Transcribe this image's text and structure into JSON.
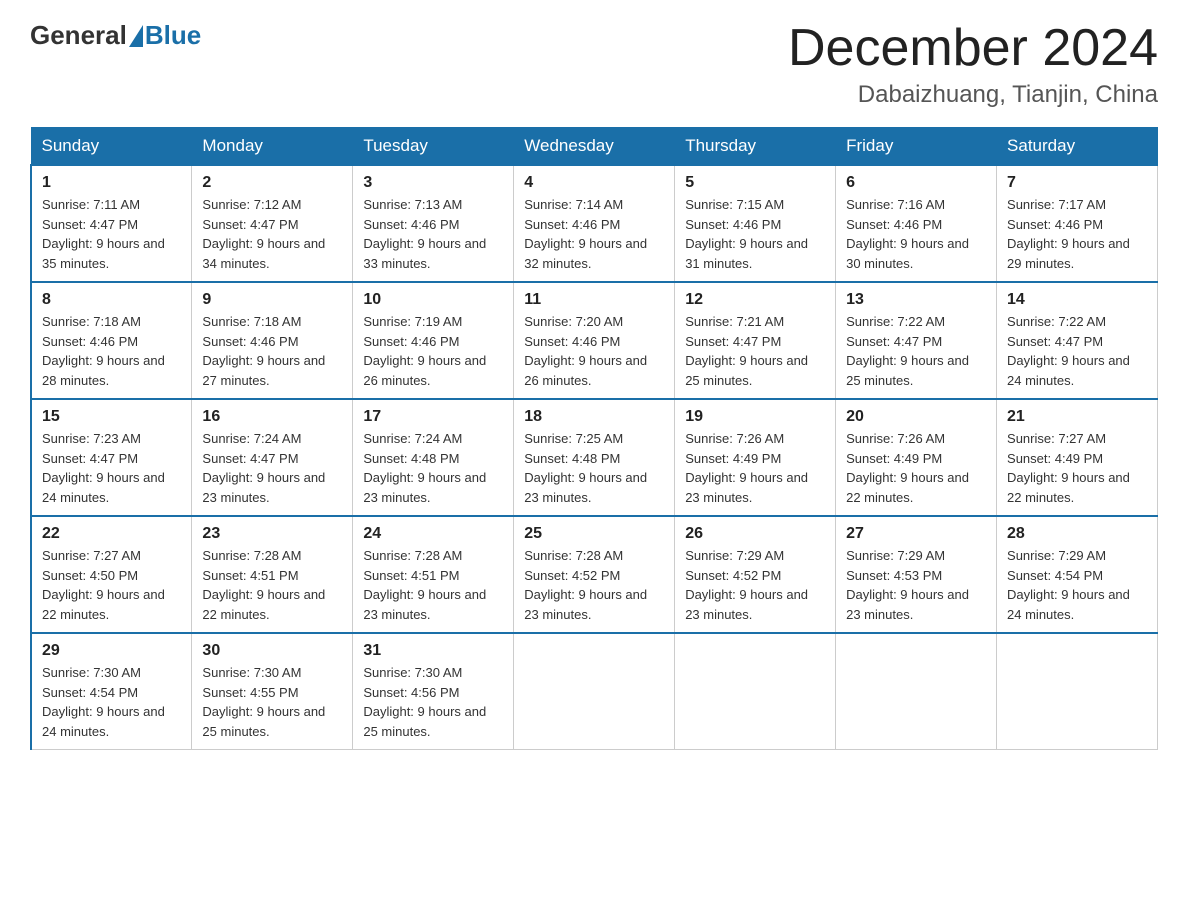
{
  "header": {
    "logo_general": "General",
    "logo_blue": "Blue",
    "month_title": "December 2024",
    "location": "Dabaizhuang, Tianjin, China"
  },
  "weekdays": [
    "Sunday",
    "Monday",
    "Tuesday",
    "Wednesday",
    "Thursday",
    "Friday",
    "Saturday"
  ],
  "weeks": [
    [
      {
        "day": "1",
        "sunrise": "Sunrise: 7:11 AM",
        "sunset": "Sunset: 4:47 PM",
        "daylight": "Daylight: 9 hours and 35 minutes."
      },
      {
        "day": "2",
        "sunrise": "Sunrise: 7:12 AM",
        "sunset": "Sunset: 4:47 PM",
        "daylight": "Daylight: 9 hours and 34 minutes."
      },
      {
        "day": "3",
        "sunrise": "Sunrise: 7:13 AM",
        "sunset": "Sunset: 4:46 PM",
        "daylight": "Daylight: 9 hours and 33 minutes."
      },
      {
        "day": "4",
        "sunrise": "Sunrise: 7:14 AM",
        "sunset": "Sunset: 4:46 PM",
        "daylight": "Daylight: 9 hours and 32 minutes."
      },
      {
        "day": "5",
        "sunrise": "Sunrise: 7:15 AM",
        "sunset": "Sunset: 4:46 PM",
        "daylight": "Daylight: 9 hours and 31 minutes."
      },
      {
        "day": "6",
        "sunrise": "Sunrise: 7:16 AM",
        "sunset": "Sunset: 4:46 PM",
        "daylight": "Daylight: 9 hours and 30 minutes."
      },
      {
        "day": "7",
        "sunrise": "Sunrise: 7:17 AM",
        "sunset": "Sunset: 4:46 PM",
        "daylight": "Daylight: 9 hours and 29 minutes."
      }
    ],
    [
      {
        "day": "8",
        "sunrise": "Sunrise: 7:18 AM",
        "sunset": "Sunset: 4:46 PM",
        "daylight": "Daylight: 9 hours and 28 minutes."
      },
      {
        "day": "9",
        "sunrise": "Sunrise: 7:18 AM",
        "sunset": "Sunset: 4:46 PM",
        "daylight": "Daylight: 9 hours and 27 minutes."
      },
      {
        "day": "10",
        "sunrise": "Sunrise: 7:19 AM",
        "sunset": "Sunset: 4:46 PM",
        "daylight": "Daylight: 9 hours and 26 minutes."
      },
      {
        "day": "11",
        "sunrise": "Sunrise: 7:20 AM",
        "sunset": "Sunset: 4:46 PM",
        "daylight": "Daylight: 9 hours and 26 minutes."
      },
      {
        "day": "12",
        "sunrise": "Sunrise: 7:21 AM",
        "sunset": "Sunset: 4:47 PM",
        "daylight": "Daylight: 9 hours and 25 minutes."
      },
      {
        "day": "13",
        "sunrise": "Sunrise: 7:22 AM",
        "sunset": "Sunset: 4:47 PM",
        "daylight": "Daylight: 9 hours and 25 minutes."
      },
      {
        "day": "14",
        "sunrise": "Sunrise: 7:22 AM",
        "sunset": "Sunset: 4:47 PM",
        "daylight": "Daylight: 9 hours and 24 minutes."
      }
    ],
    [
      {
        "day": "15",
        "sunrise": "Sunrise: 7:23 AM",
        "sunset": "Sunset: 4:47 PM",
        "daylight": "Daylight: 9 hours and 24 minutes."
      },
      {
        "day": "16",
        "sunrise": "Sunrise: 7:24 AM",
        "sunset": "Sunset: 4:47 PM",
        "daylight": "Daylight: 9 hours and 23 minutes."
      },
      {
        "day": "17",
        "sunrise": "Sunrise: 7:24 AM",
        "sunset": "Sunset: 4:48 PM",
        "daylight": "Daylight: 9 hours and 23 minutes."
      },
      {
        "day": "18",
        "sunrise": "Sunrise: 7:25 AM",
        "sunset": "Sunset: 4:48 PM",
        "daylight": "Daylight: 9 hours and 23 minutes."
      },
      {
        "day": "19",
        "sunrise": "Sunrise: 7:26 AM",
        "sunset": "Sunset: 4:49 PM",
        "daylight": "Daylight: 9 hours and 23 minutes."
      },
      {
        "day": "20",
        "sunrise": "Sunrise: 7:26 AM",
        "sunset": "Sunset: 4:49 PM",
        "daylight": "Daylight: 9 hours and 22 minutes."
      },
      {
        "day": "21",
        "sunrise": "Sunrise: 7:27 AM",
        "sunset": "Sunset: 4:49 PM",
        "daylight": "Daylight: 9 hours and 22 minutes."
      }
    ],
    [
      {
        "day": "22",
        "sunrise": "Sunrise: 7:27 AM",
        "sunset": "Sunset: 4:50 PM",
        "daylight": "Daylight: 9 hours and 22 minutes."
      },
      {
        "day": "23",
        "sunrise": "Sunrise: 7:28 AM",
        "sunset": "Sunset: 4:51 PM",
        "daylight": "Daylight: 9 hours and 22 minutes."
      },
      {
        "day": "24",
        "sunrise": "Sunrise: 7:28 AM",
        "sunset": "Sunset: 4:51 PM",
        "daylight": "Daylight: 9 hours and 23 minutes."
      },
      {
        "day": "25",
        "sunrise": "Sunrise: 7:28 AM",
        "sunset": "Sunset: 4:52 PM",
        "daylight": "Daylight: 9 hours and 23 minutes."
      },
      {
        "day": "26",
        "sunrise": "Sunrise: 7:29 AM",
        "sunset": "Sunset: 4:52 PM",
        "daylight": "Daylight: 9 hours and 23 minutes."
      },
      {
        "day": "27",
        "sunrise": "Sunrise: 7:29 AM",
        "sunset": "Sunset: 4:53 PM",
        "daylight": "Daylight: 9 hours and 23 minutes."
      },
      {
        "day": "28",
        "sunrise": "Sunrise: 7:29 AM",
        "sunset": "Sunset: 4:54 PM",
        "daylight": "Daylight: 9 hours and 24 minutes."
      }
    ],
    [
      {
        "day": "29",
        "sunrise": "Sunrise: 7:30 AM",
        "sunset": "Sunset: 4:54 PM",
        "daylight": "Daylight: 9 hours and 24 minutes."
      },
      {
        "day": "30",
        "sunrise": "Sunrise: 7:30 AM",
        "sunset": "Sunset: 4:55 PM",
        "daylight": "Daylight: 9 hours and 25 minutes."
      },
      {
        "day": "31",
        "sunrise": "Sunrise: 7:30 AM",
        "sunset": "Sunset: 4:56 PM",
        "daylight": "Daylight: 9 hours and 25 minutes."
      },
      null,
      null,
      null,
      null
    ]
  ]
}
